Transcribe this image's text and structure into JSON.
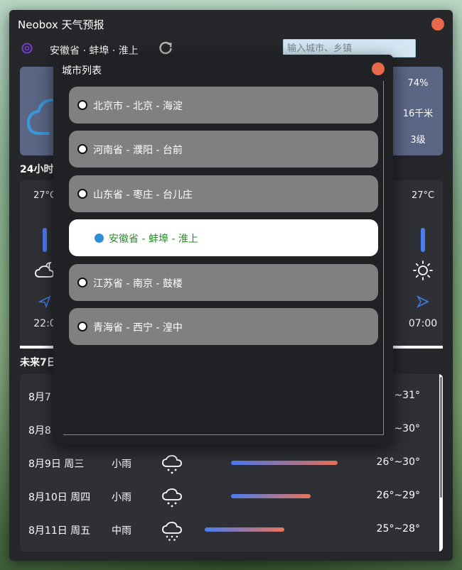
{
  "app": {
    "title": "Neobox 天气预报"
  },
  "location": {
    "current": "安徽省 · 蚌埠 · 淮上",
    "search_placeholder": "输入城市、乡镇"
  },
  "now": {
    "humidity": "74%",
    "visibility": "16千米",
    "wind_level": "3级"
  },
  "hourly": {
    "title": "24小时",
    "items": [
      {
        "temp": "27°C",
        "time": "22:0",
        "icon": "cloudy-night-icon"
      },
      {
        "temp": "27°C",
        "time": "07:00",
        "icon": "sun-icon"
      }
    ]
  },
  "daily": {
    "title": "未来7日",
    "rows": [
      {
        "date": "8月7",
        "cond": "",
        "range": "°~31°"
      },
      {
        "date": "8月8",
        "cond": "",
        "range": "°~30°"
      },
      {
        "date": "8月9日 周三",
        "cond": "小雨",
        "range": "26°~30°"
      },
      {
        "date": "8月10日 周四",
        "cond": "小雨",
        "range": "26°~29°"
      },
      {
        "date": "8月11日 周五",
        "cond": "中雨",
        "range": "25°~28°"
      }
    ]
  },
  "city_dialog": {
    "title": "城市列表",
    "cities": [
      {
        "label": "北京市 - 北京 - 海淀",
        "selected": false
      },
      {
        "label": "河南省 - 濮阳 - 台前",
        "selected": false
      },
      {
        "label": "山东省 - 枣庄 - 台儿庄",
        "selected": false
      },
      {
        "label": "安徽省 - 蚌埠 - 淮上",
        "selected": true
      },
      {
        "label": "江苏省 - 南京 - 鼓楼",
        "selected": false
      },
      {
        "label": "青海省 - 西宁 - 湟中",
        "selected": false
      }
    ]
  },
  "colors": {
    "accent_close": "#e8684a",
    "selected_city_text": "#2a8a2a",
    "radio_selected": "#2e8fd6"
  }
}
